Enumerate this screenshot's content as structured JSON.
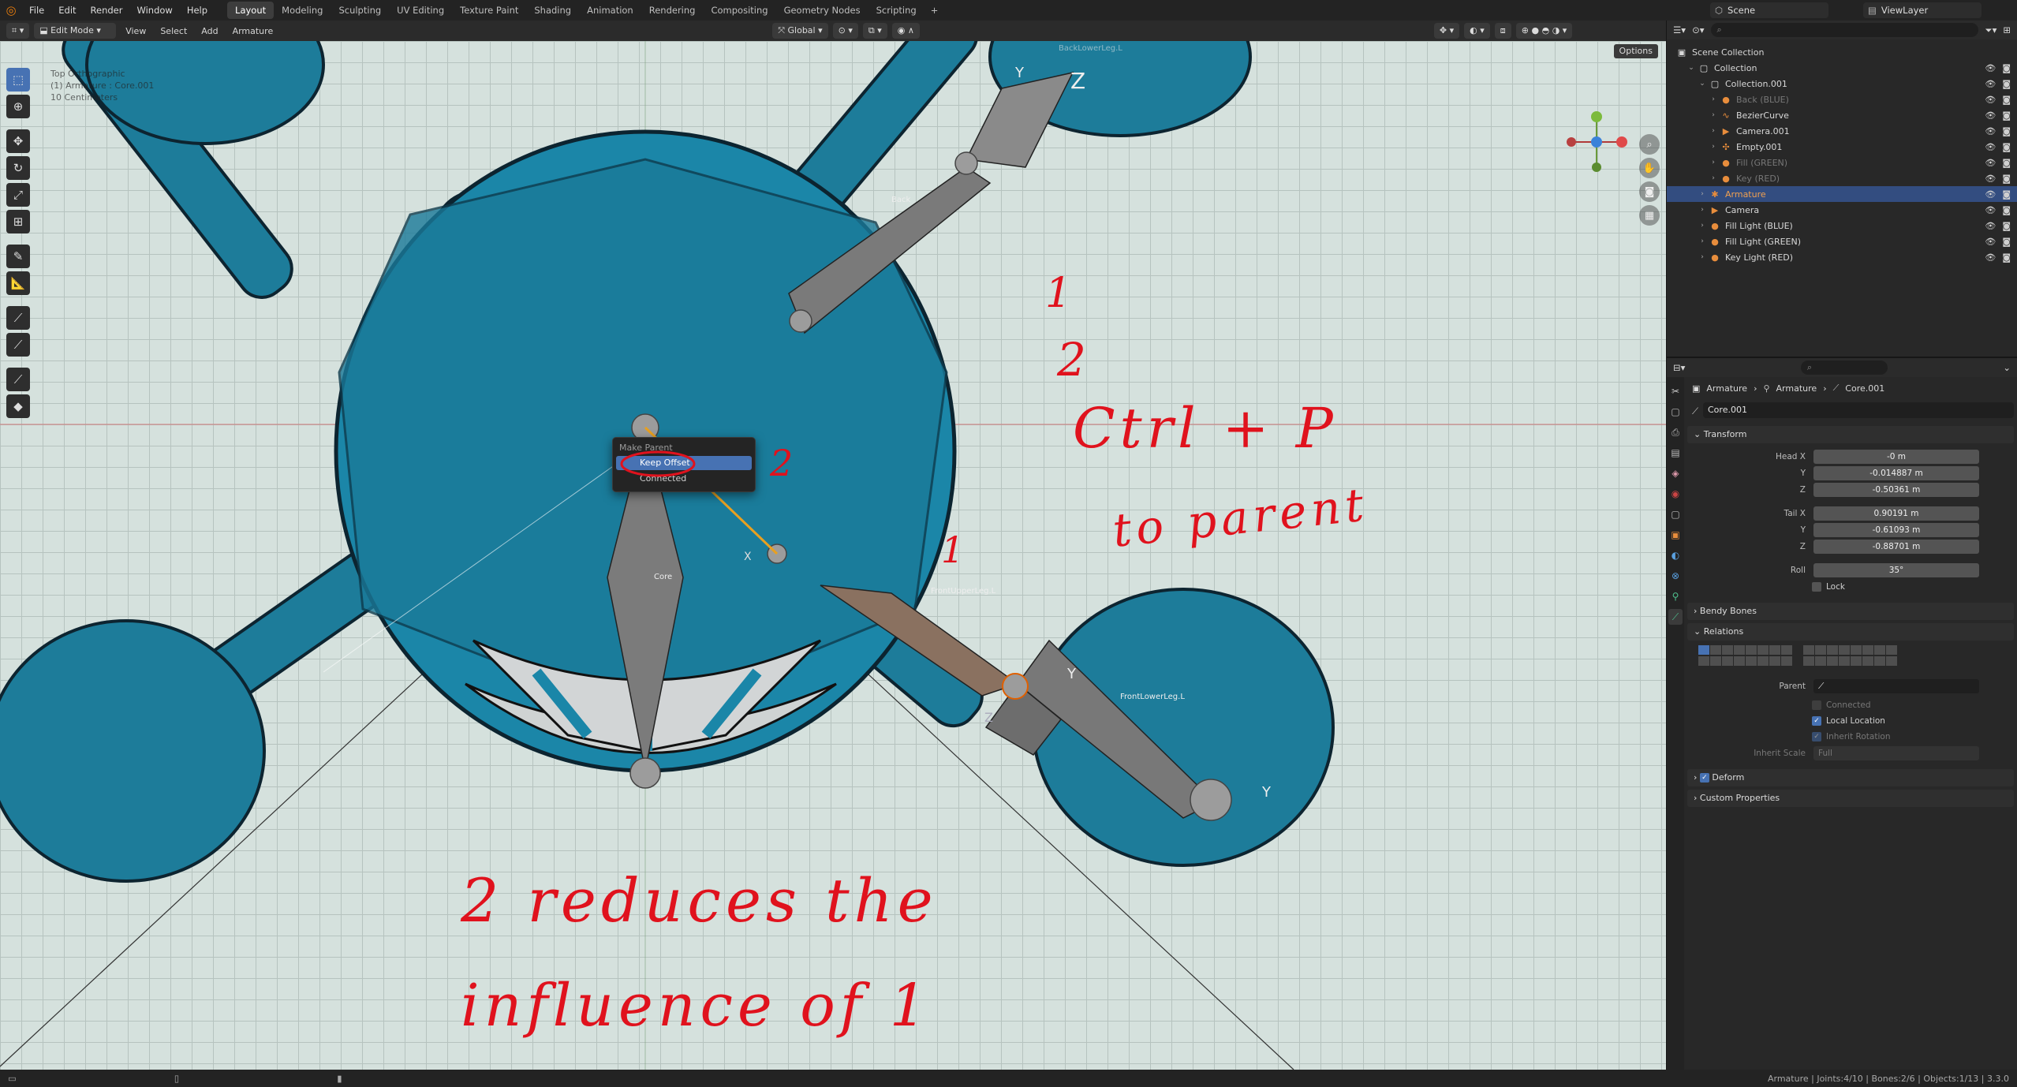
{
  "topbar": {
    "menus": [
      "File",
      "Edit",
      "Render",
      "Window",
      "Help"
    ],
    "workspaces": [
      "Layout",
      "Modeling",
      "Sculpting",
      "UV Editing",
      "Texture Paint",
      "Shading",
      "Animation",
      "Rendering",
      "Compositing",
      "Geometry Nodes",
      "Scripting"
    ],
    "active_workspace": "Layout",
    "scene": "Scene",
    "view_layer": "ViewLayer"
  },
  "viewport_header": {
    "mode": "Edit Mode",
    "menus": [
      "View",
      "Select",
      "Add",
      "Armature"
    ],
    "transform_orientation": "Global",
    "options": "Options"
  },
  "viewport": {
    "info_lines": [
      "Top Orthographic",
      "(1) Armature : Core.001",
      "10 Centimeters"
    ],
    "bone_labels": {
      "back_lower": "BackLowerLeg.L",
      "back": "Back",
      "core": "Core",
      "front_upper": "FrontUpperLeg.L",
      "front_lower": "FrontLowerLeg.L"
    },
    "axis_labels": [
      "Y",
      "Z",
      "X",
      "Y",
      "Z",
      "Y"
    ]
  },
  "popup": {
    "title": "Make Parent",
    "items": [
      "Keep Offset",
      "Connected"
    ],
    "highlighted": "Keep Offset"
  },
  "annotations": {
    "num1_top": "1",
    "num2_top": "2",
    "ctrl_p": "Ctrl + P",
    "to_parent": "to parent",
    "num2_popup": "2",
    "num1_bone": "1",
    "line1": "2  reduces  the",
    "line2": "influence  of  1"
  },
  "outliner": {
    "root": "Scene Collection",
    "rows": [
      {
        "depth": 1,
        "label": "Collection",
        "icon": "collection-icon",
        "dim": false
      },
      {
        "depth": 2,
        "label": "Collection.001",
        "icon": "collection-icon",
        "dim": false
      },
      {
        "depth": 3,
        "label": "Back (BLUE)",
        "icon": "light-icon",
        "dim": true
      },
      {
        "depth": 3,
        "label": "BezierCurve",
        "icon": "curve-icon",
        "dim": false
      },
      {
        "depth": 3,
        "label": "Camera.001",
        "icon": "camera-icon",
        "dim": false
      },
      {
        "depth": 3,
        "label": "Empty.001",
        "icon": "empty-icon",
        "dim": false
      },
      {
        "depth": 3,
        "label": "Fill (GREEN)",
        "icon": "light-icon",
        "dim": true
      },
      {
        "depth": 3,
        "label": "Key (RED)",
        "icon": "light-icon",
        "dim": true
      },
      {
        "depth": 2,
        "label": "Armature",
        "icon": "armature-icon",
        "dim": false,
        "selected": true
      },
      {
        "depth": 2,
        "label": "Camera",
        "icon": "camera-icon",
        "dim": false
      },
      {
        "depth": 2,
        "label": "Fill Light (BLUE)",
        "icon": "light-icon",
        "dim": false
      },
      {
        "depth": 2,
        "label": "Fill Light (GREEN)",
        "icon": "light-icon",
        "dim": false
      },
      {
        "depth": 2,
        "label": "Key Light (RED)",
        "icon": "light-icon",
        "dim": false
      }
    ]
  },
  "properties": {
    "breadcrumb": [
      "Armature",
      "Armature",
      "Core.001"
    ],
    "bone_name": "Core.001",
    "transform_title": "Transform",
    "head": {
      "x_label": "Head X",
      "x": "-0 m",
      "y_label": "Y",
      "y": "-0.014887 m",
      "z_label": "Z",
      "z": "-0.50361 m"
    },
    "tail": {
      "x_label": "Tail X",
      "x": "0.90191 m",
      "y_label": "Y",
      "y": "-0.61093 m",
      "z_label": "Z",
      "z": "-0.88701 m"
    },
    "roll_label": "Roll",
    "roll": "35°",
    "lock": "Lock",
    "bendy_bones": "Bendy Bones",
    "relations": "Relations",
    "parent_label": "Parent",
    "connected": "Connected",
    "local_location": "Local Location",
    "inherit_rotation": "Inherit Rotation",
    "inherit_scale_label": "Inherit Scale",
    "inherit_scale": "Full",
    "deform": "Deform",
    "custom_properties": "Custom Properties"
  },
  "status": {
    "stats": "Armature | Joints:4/10 | Bones:2/6 | Objects:1/13 | 3.3.0"
  }
}
